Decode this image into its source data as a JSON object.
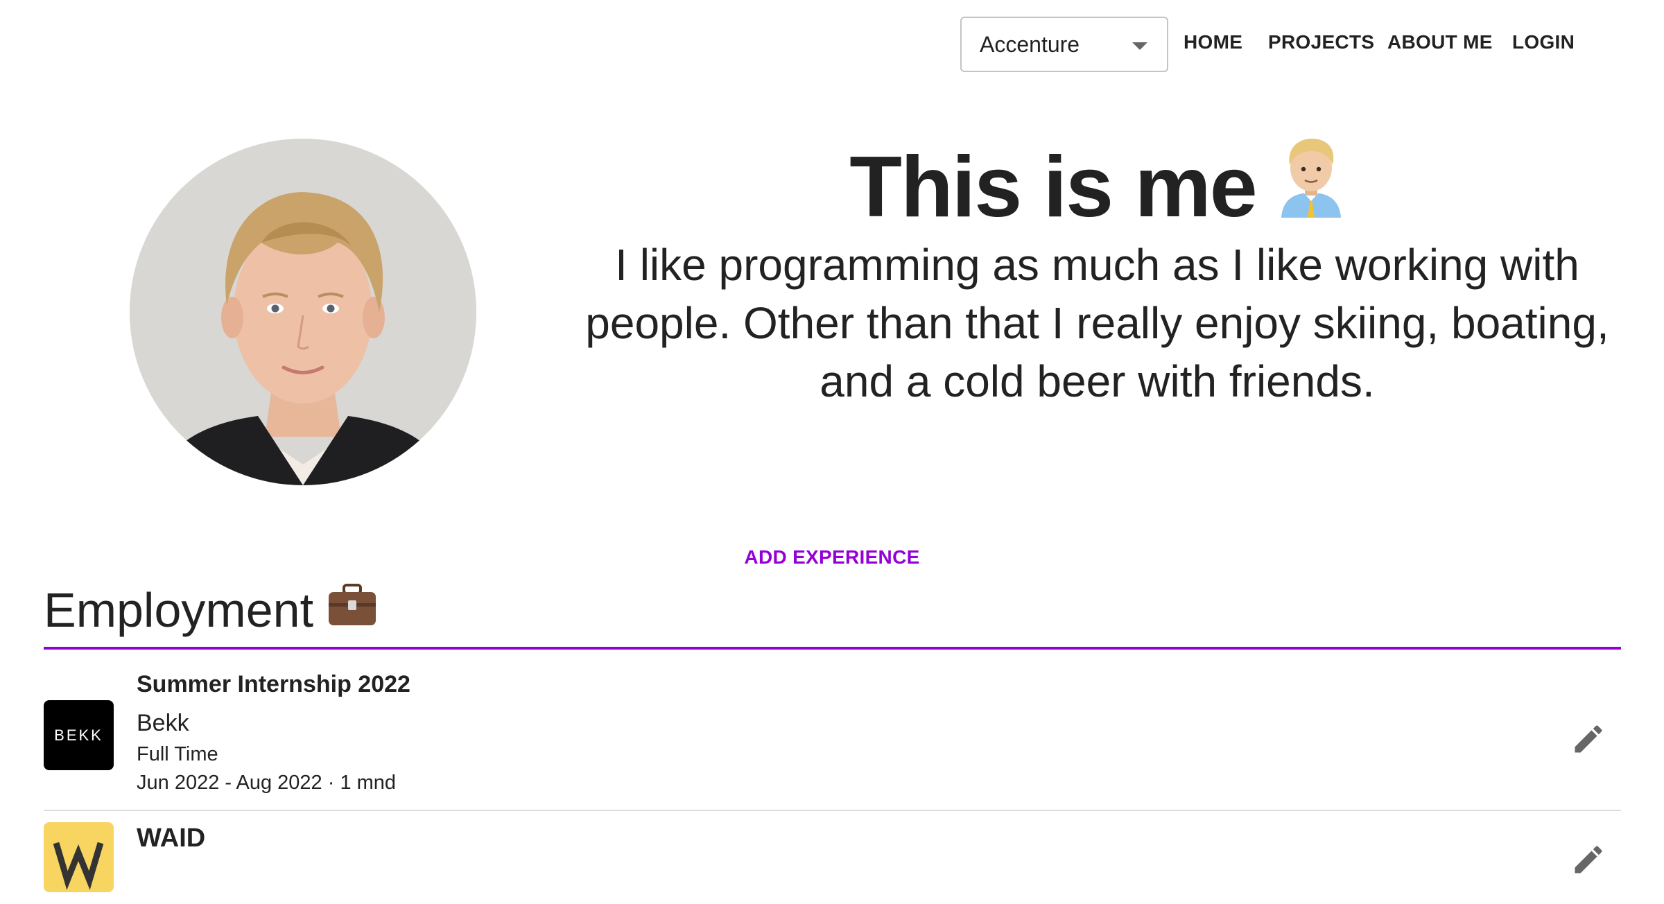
{
  "nav": {
    "company_select": {
      "value": "Accenture",
      "icon": "caret-down-icon"
    },
    "links": {
      "home": "HOME",
      "projects": "PROJECTS",
      "about": "ABOUT ME",
      "login": "LOGIN"
    }
  },
  "hero": {
    "title": "This is me",
    "title_emoji": "man-office-worker-icon",
    "text": "I like programming as much as I like working with people. Other than that I really enjoy skiing, boating, and a cold beer with friends."
  },
  "actions": {
    "add_experience": "ADD EXPERIENCE"
  },
  "employment": {
    "title": "Employment",
    "title_emoji": "briefcase-icon",
    "accent_color": "#9500d6",
    "jobs": [
      {
        "title": "Summer Internship 2022",
        "company": "Bekk",
        "logo_text": "BEKK",
        "logo_color": "#000000",
        "type": "Full Time",
        "dates": "Jun 2022 - Aug 2022 · 1 mnd"
      },
      {
        "title": "WAID",
        "company": "",
        "logo_text": "W",
        "logo_color": "#f8d560",
        "type": "",
        "dates": ""
      }
    ]
  }
}
